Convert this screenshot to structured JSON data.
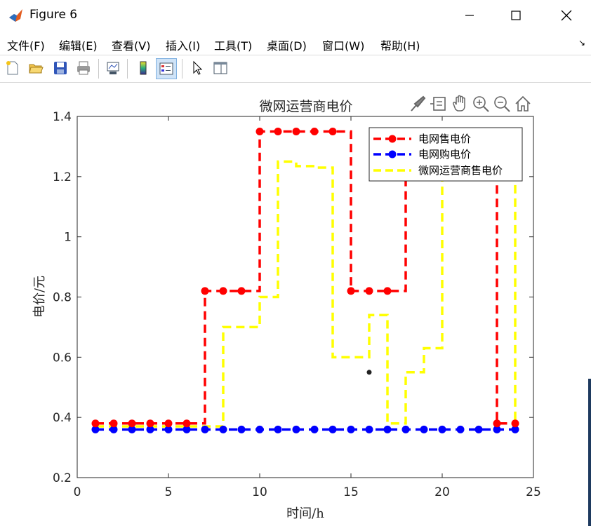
{
  "window": {
    "title": "Figure 6"
  },
  "menu": [
    "文件(F)",
    "编辑(E)",
    "查看(V)",
    "插入(I)",
    "工具(T)",
    "桌面(D)",
    "窗口(W)",
    "帮助(H)"
  ],
  "toolbar_icons": [
    "new-file-icon",
    "open-folder-icon",
    "save-icon",
    "print-icon",
    "link-plot-icon",
    "colorbar-icon",
    "legend-icon",
    "pointer-icon",
    "property-editor-icon"
  ],
  "axes_toolbar_icons": [
    "brush-icon",
    "data-tip-icon",
    "pan-icon",
    "zoom-in-icon",
    "zoom-out-icon",
    "home-icon"
  ],
  "colors": {
    "sell": "#ff0000",
    "buy": "#0000ff",
    "mg": "#ffff00"
  },
  "chart_data": {
    "type": "line",
    "title": "微网运营商电价",
    "xlabel": "时间/h",
    "ylabel": "电价/元",
    "xlim": [
      0,
      25
    ],
    "ylim": [
      0.2,
      1.4
    ],
    "xticks": [
      0,
      5,
      10,
      15,
      20,
      25
    ],
    "yticks": [
      0.2,
      0.4,
      0.6,
      0.8,
      1,
      1.2,
      1.4
    ],
    "xtick_labels": [
      "0",
      "5",
      "10",
      "15",
      "20",
      "25"
    ],
    "ytick_labels": [
      "0.2",
      "0.4",
      "0.6",
      "0.8",
      "1",
      "1.2",
      "1.4"
    ],
    "legend_position": "top-right",
    "x": [
      1,
      2,
      3,
      4,
      5,
      6,
      7,
      8,
      9,
      10,
      11,
      12,
      13,
      14,
      15,
      16,
      17,
      18,
      19,
      20,
      21,
      22,
      23,
      24
    ],
    "series": [
      {
        "name": "电网售电价",
        "style": "step-dashed-markers",
        "values": [
          0.38,
          0.38,
          0.38,
          0.38,
          0.38,
          0.38,
          0.82,
          0.82,
          0.82,
          1.35,
          1.35,
          1.35,
          1.35,
          1.35,
          0.82,
          0.82,
          0.82,
          1.35,
          1.35,
          1.35,
          1.35,
          1.35,
          0.38,
          0.38
        ]
      },
      {
        "name": "电网购电价",
        "style": "step-dashed-markers",
        "values": [
          0.36,
          0.36,
          0.36,
          0.36,
          0.36,
          0.36,
          0.36,
          0.36,
          0.36,
          0.36,
          0.36,
          0.36,
          0.36,
          0.36,
          0.36,
          0.36,
          0.36,
          0.36,
          0.36,
          0.36,
          0.36,
          0.36,
          0.36,
          0.36
        ]
      },
      {
        "name": "微网运营商售电价",
        "style": "step-dashed",
        "values": [
          0.37,
          0.37,
          0.37,
          0.37,
          0.37,
          0.37,
          0.37,
          0.7,
          0.7,
          0.8,
          1.25,
          1.235,
          1.23,
          0.6,
          0.6,
          0.74,
          0.38,
          0.55,
          0.63,
          1.3,
          1.3,
          1.3,
          1.3,
          0.37
        ]
      }
    ],
    "annotation_point": {
      "x": 16,
      "y": 0.55
    }
  }
}
